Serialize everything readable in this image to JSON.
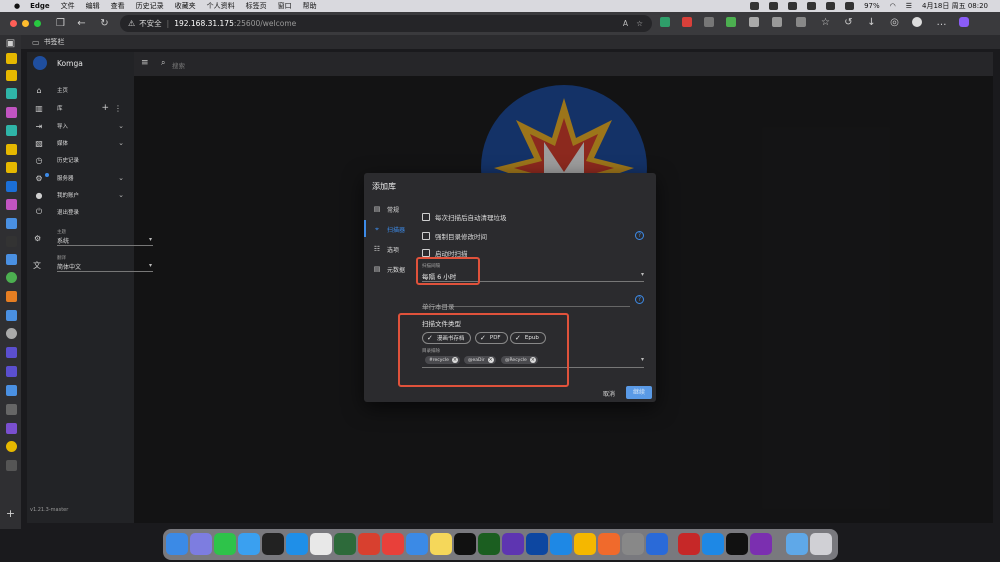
{
  "menubar": {
    "app": "Edge",
    "items": [
      "文件",
      "编辑",
      "查看",
      "历史记录",
      "收藏夹",
      "个人资料",
      "标签页",
      "窗口",
      "帮助"
    ],
    "battery": "97%",
    "datetime": "4月18日 周五  08:20"
  },
  "browser": {
    "insecure_label": "不安全",
    "url_host": "192.168.31.175",
    "url_rest": ":25600/welcome",
    "bookmarks_folder": "书签栏"
  },
  "app": {
    "name": "Komga",
    "search_placeholder": "搜索",
    "version": "v1.21.3-master"
  },
  "nav": {
    "home": "主页",
    "libraries": "库",
    "import": "导入",
    "media": "媒体",
    "history": "历史记录",
    "server": "服务器",
    "account": "我的账户",
    "logout": "退出登录",
    "theme_label": "主题",
    "theme_value": "系统",
    "language_label": "翻译",
    "language_value": "简体中文"
  },
  "dialog": {
    "title": "添加库",
    "tabs": [
      {
        "label": "常规",
        "icon": "book-icon",
        "active": false
      },
      {
        "label": "扫描器",
        "icon": "scan-icon",
        "active": true
      },
      {
        "label": "选项",
        "icon": "tune-icon",
        "active": false
      },
      {
        "label": "元数据",
        "icon": "metadata-icon",
        "active": false
      }
    ],
    "checkbox_empty_trash": "每次扫描后自动清理垃圾",
    "checkbox_force_modified": "强制目录修改时间",
    "checkbox_scan_on_startup": "启动时扫描",
    "scan_interval_label": "扫描间隔",
    "scan_interval_value": "每隔 6 小时",
    "oneshots_placeholder": "单行本目录",
    "file_types_title": "扫描文件类型",
    "file_types": [
      "漫画书存档",
      "PDF",
      "Epub"
    ],
    "exclusions_label": "目录排除",
    "exclusions": [
      "#recycle",
      "@eaDir",
      "@Recycle"
    ],
    "cancel": "取消",
    "submit": "继续"
  },
  "colors": {
    "accent": "#3d8be8",
    "highlight_box": "#e0523b",
    "dialog_bg": "#2b2b2e",
    "drawer_bg": "#222326"
  }
}
